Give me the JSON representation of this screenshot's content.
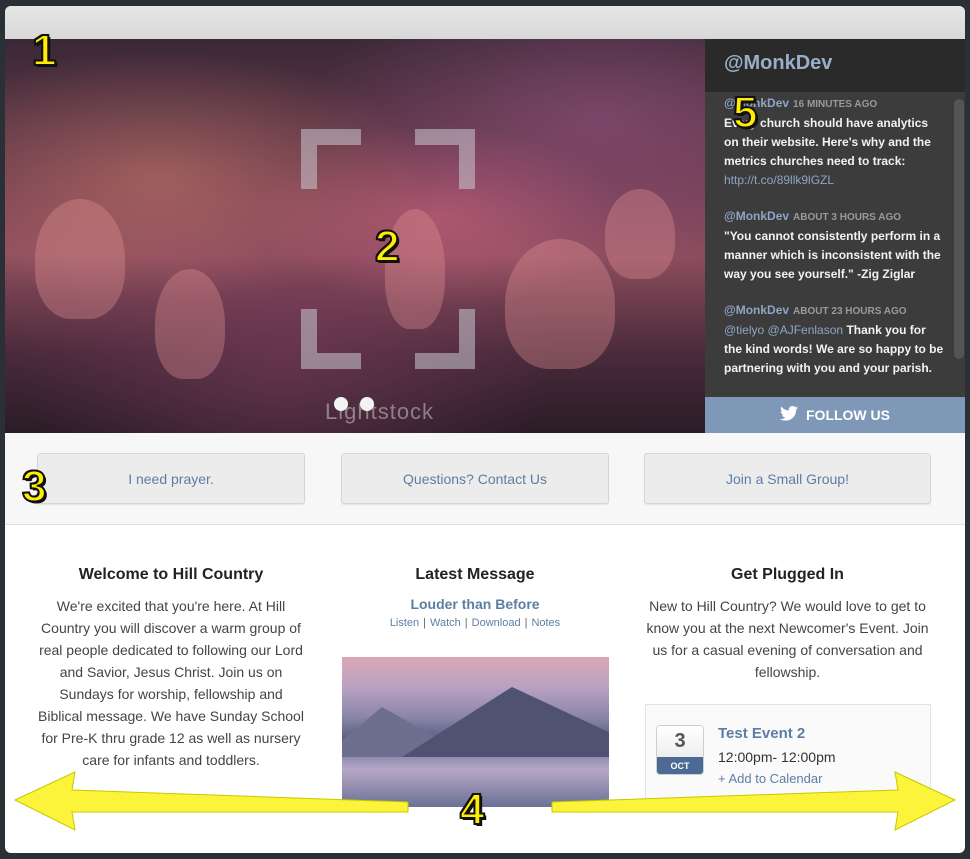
{
  "twitter": {
    "handle": "@MonkDev",
    "tweets": [
      {
        "user": "@MonkDev",
        "time": "16 MINUTES AGO",
        "text": "Every church should have analytics on their website. Here's why and the metrics churches need to track:",
        "link": "http://t.co/89llk9lGZL"
      },
      {
        "user": "@MonkDev",
        "time": "ABOUT 3 HOURS AGO",
        "text": "\"You cannot consistently perform in a manner which is inconsistent with the way you see yourself.\" -Zig Ziglar"
      },
      {
        "user": "@MonkDev",
        "time": "ABOUT 23 HOURS AGO",
        "mentions": "@tielyo @AJFenlason",
        "text": "Thank you for the kind words! We are so happy to be partnering with you and your parish."
      }
    ],
    "follow_label": "FOLLOW US"
  },
  "hero": {
    "watermark": "Lightstock"
  },
  "actions": {
    "prayer": "I need prayer.",
    "contact": "Questions? Contact Us",
    "group": "Join a Small Group!"
  },
  "welcome": {
    "title": "Welcome to Hill Country",
    "body": "We're excited that you're here. At Hill Country you will discover a warm group of real people dedicated to following our Lord and Savior, Jesus Christ. Join us on Sundays for worship, fellowship and Biblical message. We have Sunday School for Pre-K thru grade 12 as well as nursery care for infants and toddlers."
  },
  "message": {
    "title": "Latest Message",
    "sermon": "Louder than Before",
    "links": [
      "Listen",
      "Watch",
      "Download",
      "Notes"
    ]
  },
  "plugged": {
    "title": "Get Plugged In",
    "body": "New to Hill Country? We would love to get to know you at the next Newcomer's Event. Join us for a casual evening of conversation and fellowship.",
    "event": {
      "day": "3",
      "month": "OCT",
      "title": "Test Event 2",
      "time": "12:00pm- 12:00pm",
      "add": "+ Add to Calendar"
    }
  },
  "annotations": [
    "1",
    "2",
    "3",
    "4",
    "5"
  ]
}
